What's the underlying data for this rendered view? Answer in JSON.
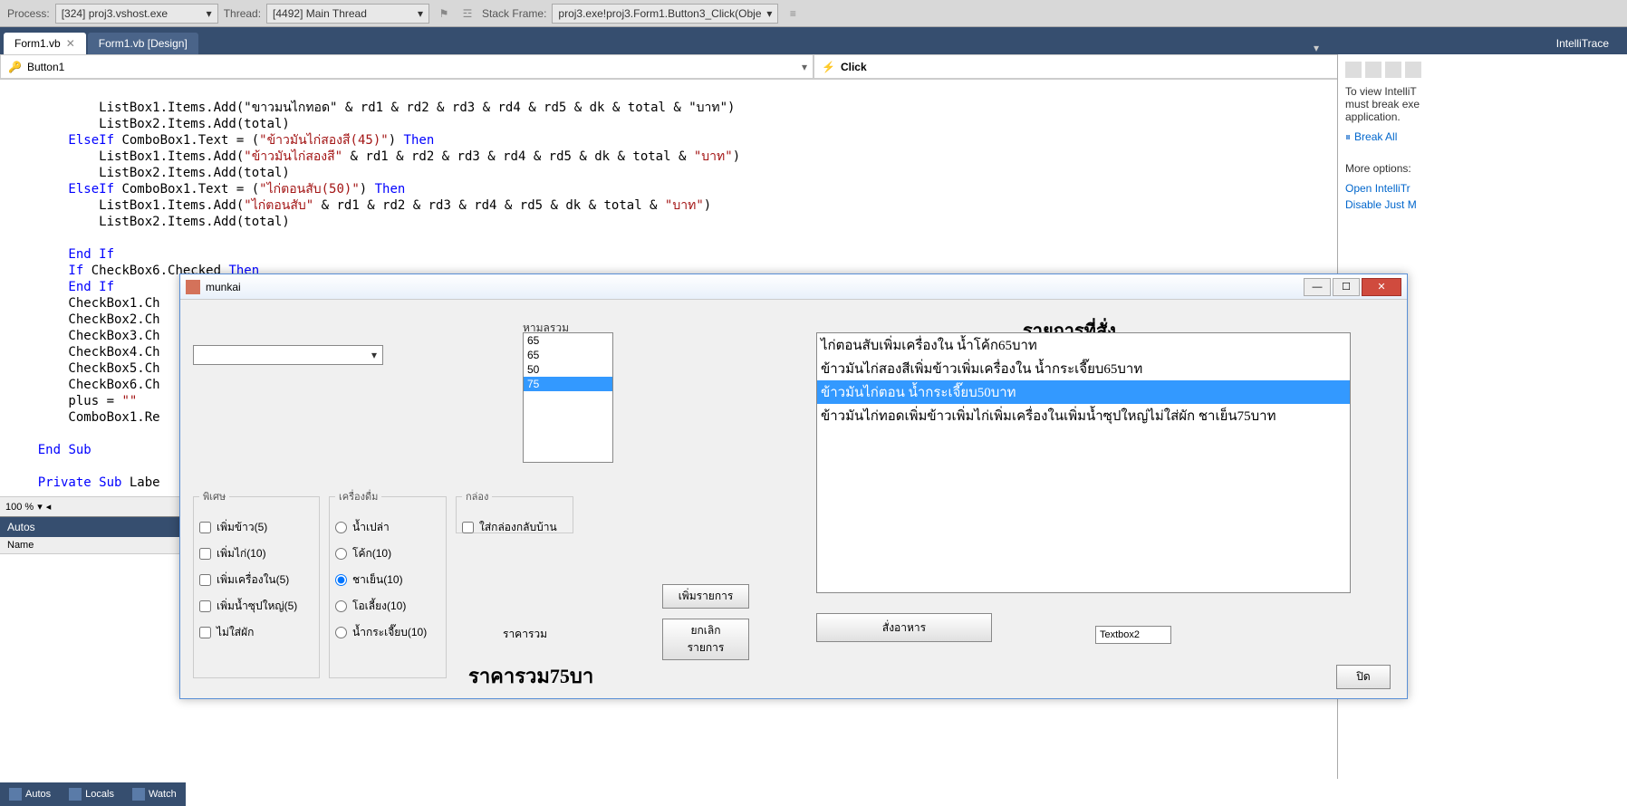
{
  "debugBar": {
    "processLabel": "Process:",
    "processValue": "[324] proj3.vshost.exe",
    "threadLabel": "Thread:",
    "threadValue": "[4492] Main Thread",
    "stackLabel": "Stack Frame:",
    "stackValue": "proj3.exe!proj3.Form1.Button3_Click(Obje"
  },
  "tabs": {
    "active": "Form1.vb",
    "inactive": "Form1.vb [Design]",
    "sidePanel": "IntelliTrace"
  },
  "dropdowns": {
    "left": "Button1",
    "right": "Click"
  },
  "code": {
    "l1": "            ListBox1.Items.Add(\"ขาวมนไกทอด\" & rd1 & rd2 & rd3 & rd4 & rd5 & dk & total & \"บาท\")",
    "l2": "            ListBox2.Items.Add(total)",
    "l3a": "        ElseIf",
    "l3b": " ComboBox1.Text = (",
    "l3c": "\"ข้าวมันไก่สองสี(45)\"",
    "l3d": ") ",
    "l3e": "Then",
    "l4a": "            ListBox1.Items.Add(",
    "l4b": "\"ข้าวมันไก่สองสี\"",
    "l4c": " & rd1 & rd2 & rd3 & rd4 & rd5 & dk & total & ",
    "l4d": "\"บาท\"",
    "l4e": ")",
    "l5": "            ListBox2.Items.Add(total)",
    "l6a": "        ElseIf",
    "l6b": " ComboBox1.Text = (",
    "l6c": "\"ไก่ตอนสับ(50)\"",
    "l6d": ") ",
    "l6e": "Then",
    "l7a": "            ListBox1.Items.Add(",
    "l7b": "\"ไก่ตอนสับ\"",
    "l7c": " & rd1 & rd2 & rd3 & rd4 & rd5 & dk & total & ",
    "l7d": "\"บาท\"",
    "l7e": ")",
    "l8": "            ListBox2.Items.Add(total)",
    "l9": "",
    "l10a": "        End",
    "l10b": " ",
    "l10c": "If",
    "l11a": "        If",
    "l11b": " CheckBox6.Checked ",
    "l11c": "Then",
    "l12a": "        End",
    "l12b": " ",
    "l12c": "If",
    "l13": "        CheckBox1.Ch",
    "l14": "        CheckBox2.Ch",
    "l15": "        CheckBox3.Ch",
    "l16": "        CheckBox4.Ch",
    "l17": "        CheckBox5.Ch",
    "l18": "        CheckBox6.Ch",
    "l19a": "        plus = ",
    "l19b": "\"\"",
    "l20": "        ComboBox1.Re",
    "l21": "",
    "l22a": "    End",
    "l22b": " ",
    "l22c": "Sub",
    "l23": "",
    "l24a": "    Private",
    "l24b": " ",
    "l24c": "Sub",
    "l24d": " Labe"
  },
  "zoom": "100 %",
  "autos": {
    "title": "Autos",
    "col": "Name"
  },
  "bottomTabs": {
    "autos": "Autos",
    "locals": "Locals",
    "watch": "Watch"
  },
  "intelli": {
    "text": "To view IntelliT\nmust break exe\napplication.",
    "breakAll": "Break All",
    "more": "More options:",
    "open": "Open IntelliTr",
    "disable": "Disable Just M"
  },
  "app": {
    "title": "munkai",
    "totalLabel": "หามลรวม",
    "totals": [
      "65",
      "65",
      "50",
      "75"
    ],
    "totalSelected": 3,
    "orderTitle": "รายการที่สั่ง",
    "orders": [
      "ไก่ตอนสับเพิ่มเครื่องใน น้ำโค้ก65บาท",
      "ข้าวมันไก่สองสีเพิ่มข้าวเพิ่มเครื่องใน น้ำกระเจี๊ยบ65บาท",
      "ข้าวมันไก่ตอน น้ำกระเจี๊ยบ50บาท",
      "ข้าวมันไก่ทอดเพิ่มข้าวเพิ่มไก่เพิ่มเครื่องในเพิ่มน้ำซุปใหญ่ไม่ใส่ผัก ชาเย็น75บาท"
    ],
    "orderSelected": 2,
    "groups": {
      "special": "พิเศษ",
      "drink": "เครื่องดื่ม",
      "box": "กล่อง"
    },
    "specials": [
      "เพิ่มข้าว(5)",
      "เพิ่มไก่(10)",
      "เพิ่มเครื่องใน(5)",
      "เพิ่มน้ำซุปใหญ่(5)",
      "ไม่ใส่ผัก"
    ],
    "drinks": [
      "น้ำเปล่า",
      "โค้ก(10)",
      "ชาเย็น(10)",
      "โอเลี้ยง(10)",
      "น้ำกระเจี๊ยบ(10)"
    ],
    "drinkSelected": 2,
    "boxOption": "ใส่กล่องกลับบ้าน",
    "btnAdd": "เพิ่มรายการ",
    "btnCancel": "ยกเลิกรายการ",
    "btnOrder": "สั่งอาหาร",
    "btnClose": "ปิด",
    "textbox2": "Textbox2",
    "priceLabel": "ราคารวม",
    "priceValue": "ราคารวม75บา"
  }
}
